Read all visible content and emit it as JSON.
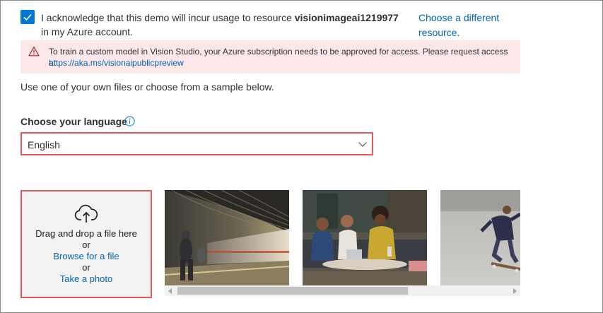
{
  "acknowledge": {
    "checked": true,
    "text_prefix": "I acknowledge that this demo will incur usage to resource ",
    "resource_name": "visionimageai1219977",
    "text_suffix": " in my Azure account.",
    "change_link": "Choose a different resource."
  },
  "warning": {
    "message": "To train a custom model in Vision Studio, your Azure subscription needs to be approved for access. Please request access at",
    "link": "https://aka.ms/visionaipublicpreview",
    "icon": "warning-triangle-icon",
    "color": "#fde7e9"
  },
  "instruction": "Use one of your own files or choose from a sample below.",
  "language": {
    "label": "Choose your language",
    "selected": "English"
  },
  "upload": {
    "drag_text": "Drag and drop a file here",
    "or1": "or",
    "browse": "Browse for a file",
    "or2": "or",
    "photo": "Take a photo"
  },
  "samples": [
    {
      "name": "sample-subway-train"
    },
    {
      "name": "sample-people-meeting"
    },
    {
      "name": "sample-skateboarder"
    }
  ],
  "colors": {
    "accent": "#0078d4",
    "link": "#0067b8",
    "highlight_border": "#e05c5c"
  }
}
